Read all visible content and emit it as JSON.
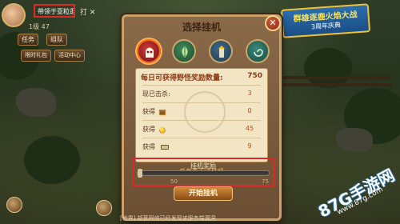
{
  "hud": {
    "player_name": "带领于亚粒逛",
    "extra": "打 ✕",
    "level_text": "1级 47",
    "buttons": [
      "任务",
      "组队"
    ],
    "small_buttons": [
      "限时礼包",
      "活动中心"
    ]
  },
  "banner": {
    "title": "群雄逐鹿火焰大战",
    "subtitle": "3周年庆典"
  },
  "dialog": {
    "title": "选择挂机",
    "close_label": "✕",
    "modes": [
      {
        "icon": "monster-icon",
        "selected": true
      },
      {
        "icon": "leaf-icon",
        "selected": false
      },
      {
        "icon": "tower-icon",
        "selected": false
      },
      {
        "icon": "swirl-icon",
        "selected": false
      }
    ],
    "daily_label": "每日可获得野怪奖励数量:",
    "daily_value": "750",
    "stats": [
      {
        "label": "现已击杀:",
        "value": "3",
        "icon": ""
      },
      {
        "label": "获得",
        "value": "0",
        "icon": "treasure-icon"
      },
      {
        "label": "获得",
        "value": "45",
        "icon": "gold-icon"
      },
      {
        "label": "获得",
        "value": "9",
        "icon": "exp-icon"
      }
    ],
    "task_note": "任务卷无法挂机",
    "reward": {
      "title": "挂机奖励",
      "ticks": [
        "50",
        "75"
      ],
      "fill_fraction": 0.0
    },
    "start_button": "开始挂机"
  },
  "chat_line": "[世界] 胡莱网络已经发现该服务端漏洞",
  "watermark": {
    "logo": "87G手游网",
    "url": "www.87g.com"
  },
  "colors": {
    "highlight_box": "#e02828",
    "value_red": "#d04014",
    "panel_bg": "#f2e5c4"
  }
}
